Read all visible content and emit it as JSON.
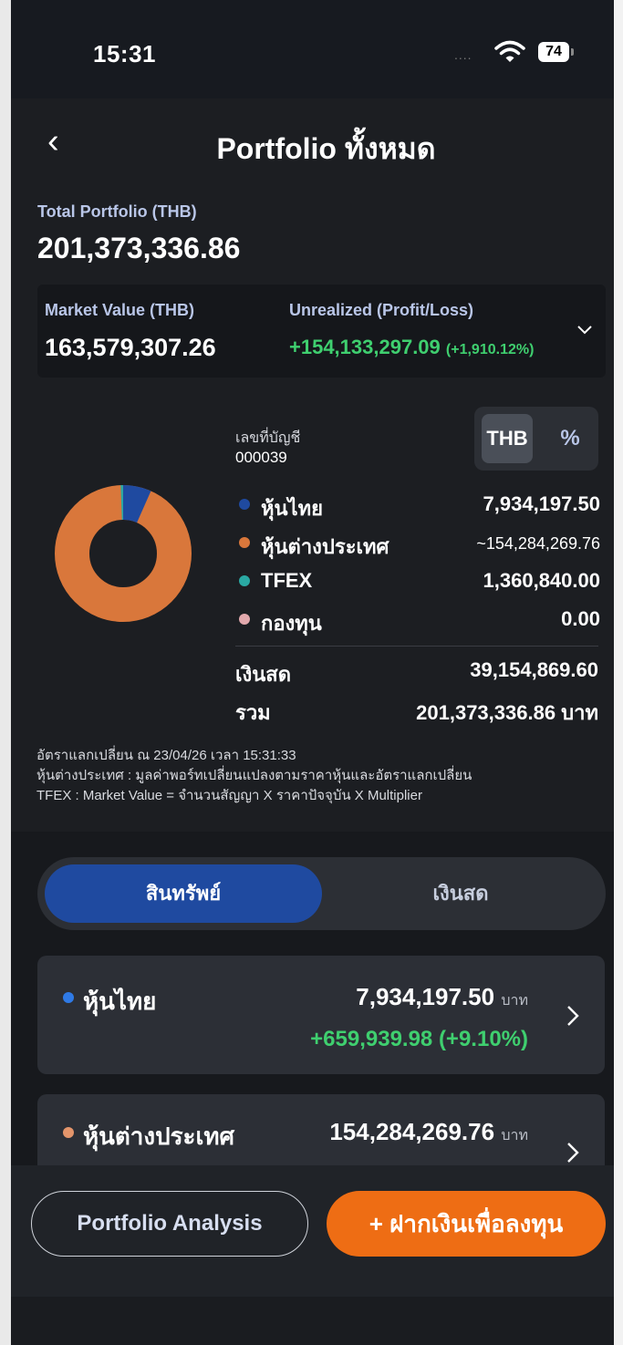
{
  "status": {
    "time": "15:31",
    "signal": "....",
    "battery": "74"
  },
  "header": {
    "title": "Portfolio ทั้งหมด"
  },
  "total": {
    "label": "Total Portfolio (THB)",
    "value": "201,373,336.86"
  },
  "market": {
    "label": "Market Value (THB)",
    "value": "163,579,307.26",
    "unrealized_label": "Unrealized (Profit/Loss)",
    "unrealized_value": "+154,133,297.09",
    "unrealized_pct": "(+1,910.12%)"
  },
  "account": {
    "label": "เลขที่บัญชี",
    "number": "000039"
  },
  "toggle": {
    "thb": "THB",
    "pct": "%"
  },
  "legend": [
    {
      "name": "หุ้นไทย",
      "value": "7,934,197.50",
      "color": "#1f4aa0"
    },
    {
      "name": "หุ้นต่างประเทศ",
      "value": "~154,284,269.76",
      "color": "#d9773b"
    },
    {
      "name": "TFEX",
      "value": "1,360,840.00",
      "color": "#2aa9a3"
    },
    {
      "name": "กองทุน",
      "value": "0.00",
      "color": "#e2a9ad"
    }
  ],
  "cash": {
    "name": "เงินสด",
    "value": "39,154,869.60"
  },
  "sum": {
    "name": "รวม",
    "value": "201,373,336.86 บาท"
  },
  "notes": [
    "อัตราแลกเปลี่ยน ณ 23/04/26 เวลา 15:31:33",
    "หุ้นต่างประเทศ : มูลค่าพอร์ทเปลี่ยนแปลงตามราคาหุ้นและอัตราแลกเปลี่ยน",
    "TFEX : Market Value = จำนวนสัญญา X ราคาปัจจุบัน X Multiplier"
  ],
  "tabs": {
    "assets": "สินทรัพย์",
    "cash": "เงินสด"
  },
  "cards": [
    {
      "name": "หุ้นไทย",
      "value": "7,934,197.50",
      "unit": "บาท",
      "pl": "+659,939.98 (+9.10%)",
      "color": "#2f7ae6"
    },
    {
      "name": "หุ้นต่างประเทศ",
      "value": "154,284,269.76",
      "unit": "บาท",
      "color": "#e4956b"
    }
  ],
  "buttons": {
    "analysis": "Portfolio Analysis",
    "deposit": "+ ฝากเงินเพื่อลงทุน"
  },
  "colors": {
    "accent": "#ee6d14",
    "profit": "#3fcf6f",
    "active_tab": "#1f4aa0"
  }
}
